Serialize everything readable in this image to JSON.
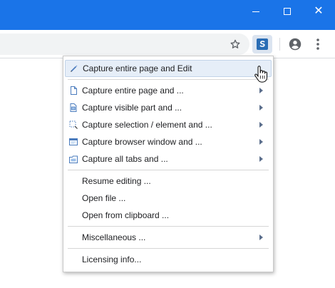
{
  "window": {
    "minimize_label": "minimize",
    "maximize_label": "maximize",
    "close_glyph": "✕"
  },
  "toolbar": {
    "bookmark_icon": "star-icon",
    "extension_icon": "screenshot-extension-icon",
    "profile_icon": "account-circle-icon",
    "menu_icon": "more-vert-icon"
  },
  "menu": {
    "items": [
      {
        "label": "Capture entire page and Edit",
        "icon": "edit-pencil-icon",
        "highlighted": true
      },
      {
        "label": "Capture entire page and ...",
        "icon": "page-icon",
        "submenu": true
      },
      {
        "label": "Capture visible part and ...",
        "icon": "visible-part-icon",
        "submenu": true
      },
      {
        "label": "Capture selection / element and ...",
        "icon": "selection-icon",
        "submenu": true
      },
      {
        "label": "Capture browser window and ...",
        "icon": "browser-window-icon",
        "submenu": true
      },
      {
        "label": "Capture all tabs and ...",
        "icon": "all-tabs-icon",
        "submenu": true
      }
    ],
    "items2": [
      {
        "label": "Resume editing ..."
      },
      {
        "label": "Open file ..."
      },
      {
        "label": "Open from clipboard ..."
      }
    ],
    "items3": [
      {
        "label": "Miscellaneous ...",
        "submenu": true
      }
    ],
    "items4": [
      {
        "label": "Licensing info..."
      }
    ]
  },
  "colors": {
    "titlebar": "#1a74e8",
    "highlight": "#e6eef8",
    "icon_blue": "#4a7bbd"
  }
}
